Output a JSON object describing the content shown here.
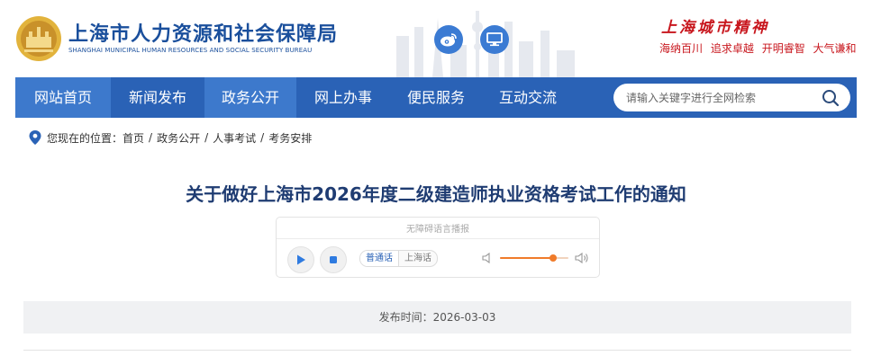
{
  "header": {
    "site_title": "上海市人力资源和社会保障局",
    "site_subtitle": "SHANGHAI MUNICIPAL HUMAN RESOURCES AND SOCIAL SECURITY BUREAU",
    "spirit_title": "上海城市精神",
    "slogans": [
      "海纳百川",
      "追求卓越",
      "开明睿智",
      "大气谦和"
    ],
    "logo_icon": "bureau-emblem-icon",
    "social_icons": [
      "weibo-icon",
      "computer-icon"
    ],
    "brand_color": "#1a4f9c",
    "accent_red": "#c8161d"
  },
  "nav": {
    "items": [
      {
        "label": "网站首页",
        "active": true
      },
      {
        "label": "新闻发布",
        "active": false
      },
      {
        "label": "政务公开",
        "active": true
      },
      {
        "label": "网上办事",
        "active": false
      },
      {
        "label": "便民服务",
        "active": false
      },
      {
        "label": "互动交流",
        "active": false
      }
    ],
    "search_placeholder": "请输入关键字进行全网检索",
    "search_icon": "search-icon",
    "background": "#2a62b6",
    "active_background": "#3d79cc"
  },
  "breadcrumb": {
    "prefix": "您现在的位置：",
    "items": [
      "首页",
      "政务公开",
      "人事考试",
      "考务安排"
    ],
    "separator": "/",
    "icon": "location-pin-icon"
  },
  "article": {
    "title": "关于做好上海市2026年度二级建造师执业资格考试工作的通知",
    "publish_label": "发布时间：2026-03-03"
  },
  "player": {
    "label": "无障碍语言播报",
    "languages": [
      {
        "label": "普通话",
        "active": true
      },
      {
        "label": "上海话",
        "active": false
      }
    ],
    "volume_percent": 78,
    "icons": [
      "play-icon",
      "stop-icon",
      "volume-low-icon",
      "volume-high-icon"
    ],
    "accent": "#f07b2a"
  }
}
